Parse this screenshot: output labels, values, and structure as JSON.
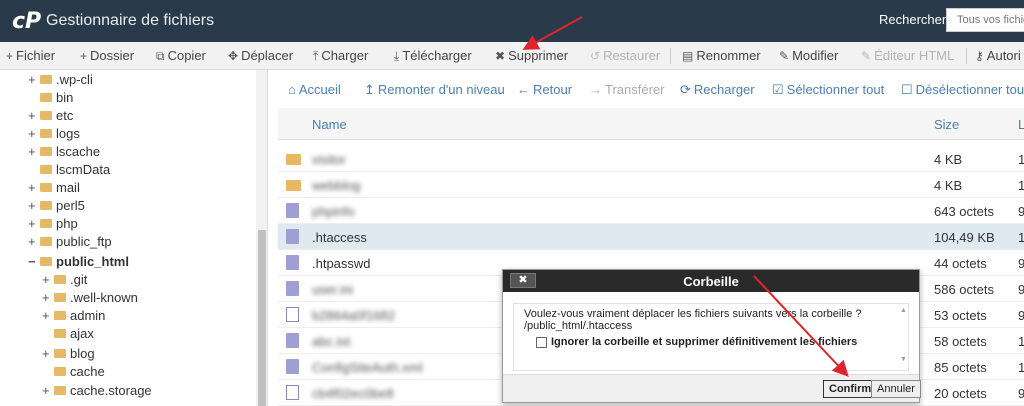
{
  "header": {
    "logo": "cP",
    "title": "Gestionnaire de fichiers",
    "search_label": "Rechercher",
    "search_placeholder": "Tous vos fichiers"
  },
  "toolbar": {
    "items": [
      {
        "label": "Fichier",
        "icon": "plus-icon",
        "glyph": "+"
      },
      {
        "label": "Dossier",
        "icon": "plus-icon",
        "glyph": "+"
      },
      {
        "label": "Copier",
        "icon": "copy-icon",
        "glyph": "⧉"
      },
      {
        "label": "Déplacer",
        "icon": "move-icon",
        "glyph": "✥"
      },
      {
        "label": "Charger",
        "icon": "upload-icon",
        "glyph": "⤒"
      },
      {
        "label": "Télécharger",
        "icon": "download-icon",
        "glyph": "⤓"
      },
      {
        "label": "Supprimer",
        "icon": "delete-icon",
        "glyph": "✖"
      },
      {
        "label": "Restaurer",
        "icon": "restore-icon",
        "glyph": "↺"
      },
      {
        "label": "Renommer",
        "icon": "rename-icon",
        "glyph": "▤"
      },
      {
        "label": "Modifier",
        "icon": "pencil-icon",
        "glyph": "✎"
      },
      {
        "label": "Éditeur HTML",
        "icon": "html-editor-icon",
        "glyph": "✎"
      },
      {
        "label": "Autori",
        "icon": "key-icon",
        "glyph": "⚷"
      }
    ]
  },
  "sidebar": {
    "items": [
      {
        "label": ".wp-cli",
        "toggle": "+"
      },
      {
        "label": "bin",
        "toggle": ""
      },
      {
        "label": "etc",
        "toggle": "+"
      },
      {
        "label": "logs",
        "toggle": "+"
      },
      {
        "label": "lscache",
        "toggle": "+"
      },
      {
        "label": "lscmData",
        "toggle": ""
      },
      {
        "label": "mail",
        "toggle": "+"
      },
      {
        "label": "perl5",
        "toggle": "+"
      },
      {
        "label": "php",
        "toggle": "+"
      },
      {
        "label": "public_ftp",
        "toggle": "+"
      },
      {
        "label": "public_html",
        "toggle": "−"
      },
      {
        "label": ".git",
        "toggle": "+"
      },
      {
        "label": ".well-known",
        "toggle": "+"
      },
      {
        "label": "admin",
        "toggle": "+"
      },
      {
        "label": "ajax",
        "toggle": ""
      },
      {
        "label": "blog",
        "toggle": "+"
      },
      {
        "label": "cache",
        "toggle": ""
      },
      {
        "label": "cache.storage",
        "toggle": "+"
      }
    ]
  },
  "nav": {
    "items": [
      {
        "label": "Accueil",
        "glyph": "⌂"
      },
      {
        "label": "Remonter d'un niveau",
        "glyph": "↥"
      },
      {
        "label": "Retour",
        "glyph": "←"
      },
      {
        "label": "Transférer",
        "glyph": "→"
      },
      {
        "label": "Recharger",
        "glyph": "⟳"
      },
      {
        "label": "Sélectionner tout",
        "glyph": "☑"
      },
      {
        "label": "Désélectionner tout",
        "glyph": "☐"
      }
    ]
  },
  "table": {
    "col_name": "Name",
    "col_size": "Size",
    "col_extra": "L",
    "rows": [
      {
        "name": "visitor",
        "size": "4 KB",
        "extra": "1",
        "type": "folder",
        "blurred": true
      },
      {
        "name": "webblog",
        "size": "4 KB",
        "extra": "1",
        "type": "folder",
        "blurred": true
      },
      {
        "name": "phpinfo",
        "size": "643 octets",
        "extra": "9",
        "type": "file",
        "blurred": true
      },
      {
        "name": ".htaccess",
        "size": "104,49 KB",
        "extra": "1",
        "type": "file",
        "blurred": false
      },
      {
        "name": ".htpasswd",
        "size": "44 octets",
        "extra": "9",
        "type": "file",
        "blurred": false
      },
      {
        "name": "user.ini",
        "size": "586 octets",
        "extra": "9",
        "type": "file",
        "blurred": true
      },
      {
        "name": "b2864a0f1682",
        "size": "53 octets",
        "extra": "9",
        "type": "text",
        "blurred": true
      },
      {
        "name": "abc.txt",
        "size": "58 octets",
        "extra": "1",
        "type": "file",
        "blurred": true
      },
      {
        "name": "ConfigSiteAuth.xml",
        "size": "85 octets",
        "extra": "1",
        "type": "file",
        "blurred": true
      },
      {
        "name": "cb4f02ec0be8",
        "size": "20 octets",
        "extra": "9",
        "type": "text",
        "blurred": true
      }
    ]
  },
  "dialog": {
    "title": "Corbeille",
    "close": "✖",
    "message": "Voulez-vous vraiment déplacer les fichiers suivants vers la corbeille ?",
    "path": "/public_html/.htaccess",
    "checkbox_label": "Ignorer la corbeille et supprimer définitivement les fichiers",
    "confirm": "Confirm",
    "cancel": "Annuler"
  },
  "colors": {
    "header_bg": "#293a4a",
    "link": "#4a7fb5",
    "selected_row": "#dfe9f0",
    "arrow": "#e0242d"
  }
}
